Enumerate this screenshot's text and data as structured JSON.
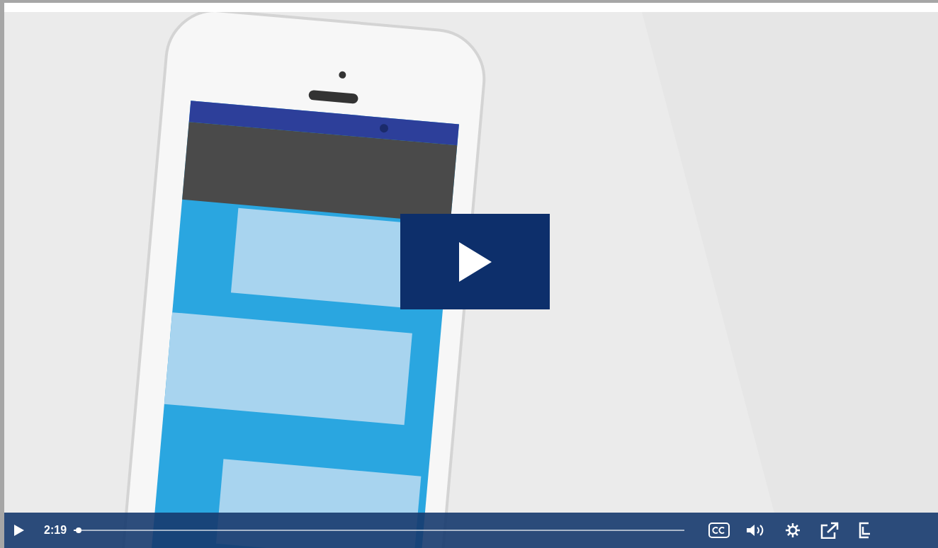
{
  "overlay": {
    "play_button": true
  },
  "controls": {
    "time": "2:19",
    "progress": {
      "level": 0.008
    }
  }
}
